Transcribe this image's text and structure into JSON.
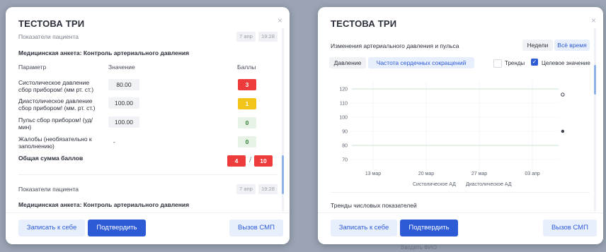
{
  "left_modal": {
    "title": "ТЕСТОВА ТРИ",
    "close_glyph": "×",
    "top_section": {
      "label": "Показатели пациента",
      "date": "7 апр",
      "time": "19:28"
    },
    "questionnaire_title": "Медицинская анкета: Контроль артериального давления",
    "headers": {
      "param": "Параметр",
      "value": "Значение",
      "score": "Баллы"
    },
    "rows": [
      {
        "param_line1": "Систолическое давление",
        "param_line2": "сбор прибором! (мм рт. ст.)",
        "value": "80.00",
        "score": "3",
        "level": "red"
      },
      {
        "param_line1": "Диастолическое давление",
        "param_line2": "сбор прибором! (мм. рт. ст.)",
        "value": "100.00",
        "score": "1",
        "level": "yellow"
      },
      {
        "param_line1": "Пульс сбор прибором! (уд/",
        "param_line2": "мин)",
        "value": "100.00",
        "score": "0",
        "level": "green"
      },
      {
        "param_line1": "Жалобы (необязательно к",
        "param_line2": "заполнению)",
        "value": "-",
        "score": "0",
        "level": "green"
      }
    ],
    "total": {
      "label": "Общая сумма баллов",
      "score": "4",
      "separator": "/",
      "max": "10"
    },
    "second_section": {
      "label": "Показатели пациента",
      "date": "7 апр",
      "time": "19:28",
      "questionnaire_title": "Медицинская анкета: Контроль артериального давления"
    },
    "buttons": {
      "record": "Записать к себе",
      "confirm": "Подтвердить",
      "ambulance": "Вызов СМП"
    }
  },
  "right_modal": {
    "title": "ТЕСТОВА ТРИ",
    "close_glyph": "×",
    "section_title": "Изменения артериального давления и пульса",
    "range_toggle": {
      "weeks": "Недели",
      "all_time": "Всё время"
    },
    "tabs": {
      "pressure": "Давление",
      "heart_rate": "Частота сердечных сокращений"
    },
    "trends_label": "Тренды",
    "target_label": "Целевое значение",
    "target_checked": true,
    "trends_checked": false,
    "legend": {
      "systolic": "Систолическое АД",
      "diastolic": "Диастолическое АД"
    },
    "numeric_trends_title": "Тренды числовых показателей",
    "buttons": {
      "record": "Записать к себе",
      "confirm": "Подтвердить",
      "ambulance": "Вызов СМП"
    },
    "bottom_peek_text": "Вводить ФИО"
  },
  "chart_data": {
    "type": "scatter",
    "y_ticks": [
      70,
      80,
      90,
      100,
      110,
      120
    ],
    "x_ticks": [
      "13 мар",
      "20 мар",
      "27 мар",
      "03 апр"
    ],
    "ylim": [
      65,
      125
    ],
    "target_lines": [
      120,
      80
    ],
    "series": [
      {
        "name": "Систолическое АД",
        "points": [
          {
            "x": "07 апр",
            "y": 116
          }
        ],
        "style": "hollow"
      },
      {
        "name": "Диастолическое АД",
        "points": [
          {
            "x": "07 апр",
            "y": 90
          }
        ],
        "style": "filled"
      }
    ],
    "colors": {
      "target_line": "#cfe9d6",
      "grid": "#eef0f3",
      "point": "#3a3f4a"
    }
  }
}
